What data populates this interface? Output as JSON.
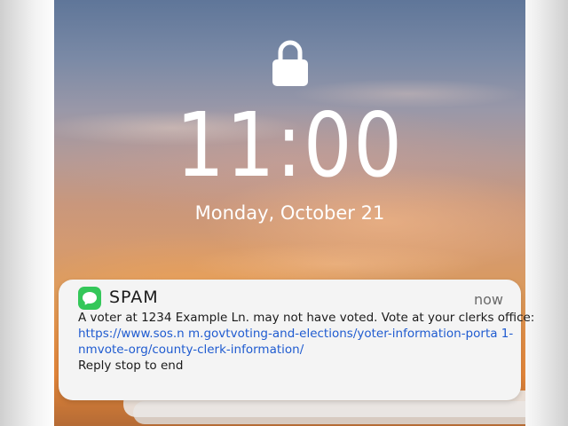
{
  "lock_screen": {
    "time": "11:00",
    "date": "Monday, October 21",
    "lock_icon": "lock-icon"
  },
  "notification": {
    "app_icon": "messages-icon",
    "app_color": "#34c759",
    "app_name": "SPAM",
    "timestamp": "now",
    "message_line": "A voter at 1234 Example Ln. may not have voted. Vote at your clerks office:",
    "link_line_1": "https://www.sos.n m.govtvoting-and-elections/yoter-information-porta 1-",
    "link_line_2": "nmvote-org/county-clerk-information/",
    "footer_line": "Reply stop to end",
    "link_color": "#1f5bd0"
  }
}
